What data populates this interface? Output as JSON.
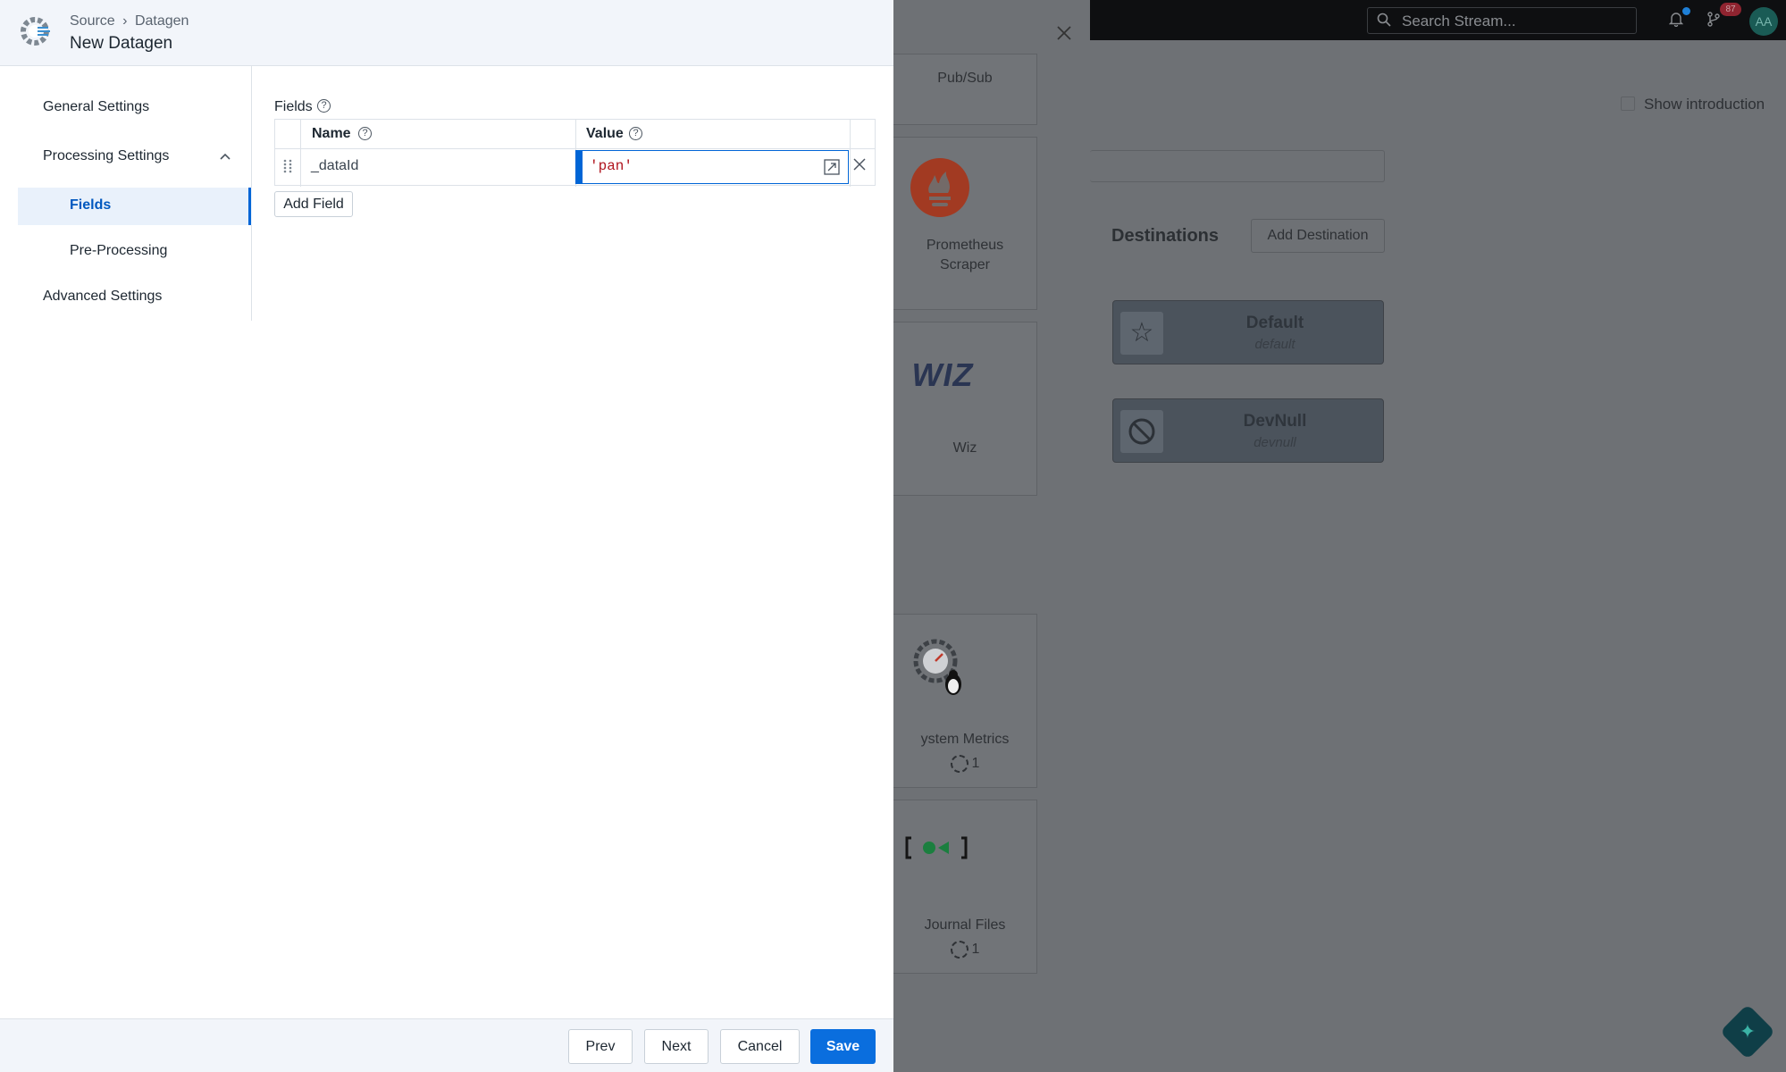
{
  "header": {
    "breadcrumb_source": "Source",
    "breadcrumb_sep": "›",
    "breadcrumb_current": "Datagen",
    "title": "New Datagen"
  },
  "sidenav": {
    "general": "General Settings",
    "processing": "Processing Settings",
    "fields": "Fields",
    "preprocessing": "Pre-Processing",
    "advanced": "Advanced Settings"
  },
  "fields_section": {
    "label": "Fields",
    "col_name": "Name",
    "col_value": "Value",
    "rows": [
      {
        "name": "_dataId",
        "value": "'pan'"
      }
    ],
    "add_field": "Add Field"
  },
  "footer": {
    "prev": "Prev",
    "next": "Next",
    "cancel": "Cancel",
    "save": "Save"
  },
  "gallery": {
    "items": [
      {
        "label": "Pub/Sub"
      },
      {
        "label": "Prometheus Scraper"
      },
      {
        "label": "Wiz",
        "logo_text": "WIZ"
      },
      {
        "label": "ystem Metrics",
        "count": "1"
      },
      {
        "label": "Journal Files",
        "count": "1"
      }
    ]
  },
  "background": {
    "search_placeholder": "Search Stream...",
    "notification_badge": "87",
    "avatar_initials": "AA",
    "show_introduction": "Show introduction",
    "destinations_title": "Destinations",
    "add_destination": "Add Destination",
    "destinations": [
      {
        "name": "Default",
        "id": "default"
      },
      {
        "name": "DevNull",
        "id": "devnull"
      }
    ]
  },
  "colors": {
    "accent": "#0065d6",
    "save": "#0a6ede",
    "value_text": "#b0141e"
  }
}
